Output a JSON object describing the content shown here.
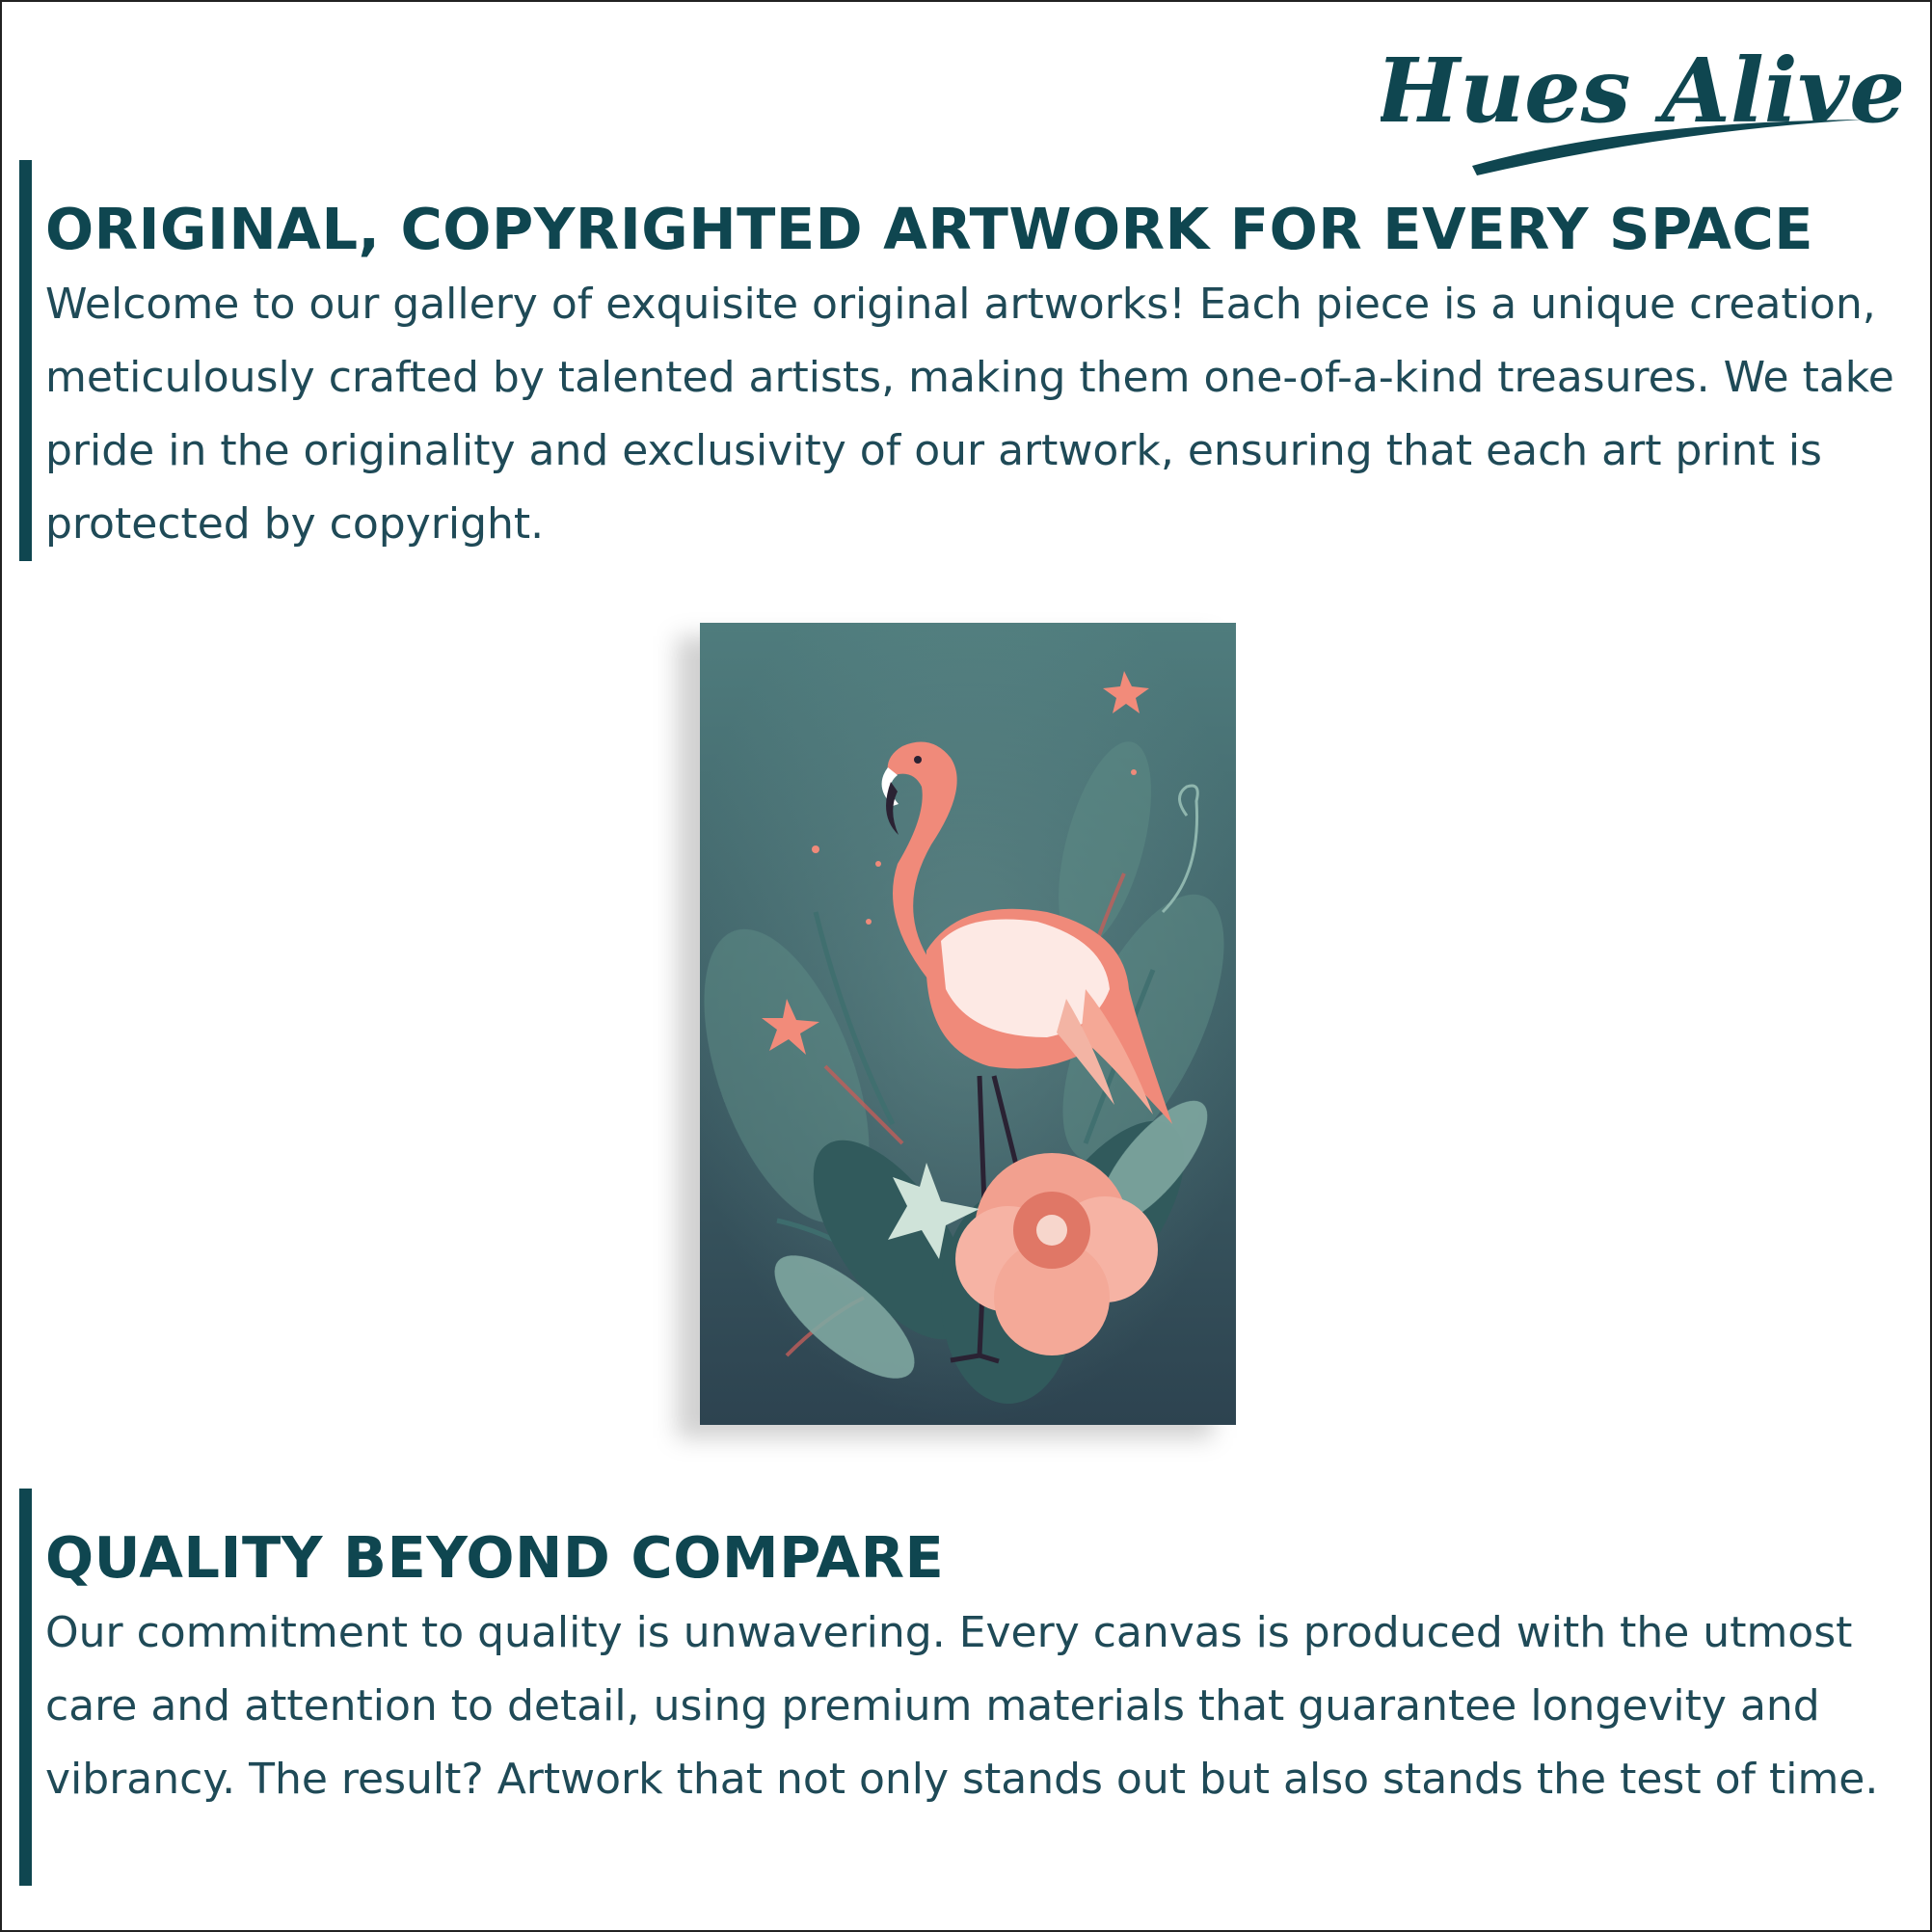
{
  "brand": {
    "logo_text": "Hues Alive"
  },
  "sections": [
    {
      "heading": "ORIGINAL, COPYRIGHTED ARTWORK FOR EVERY SPACE",
      "body": "Welcome to our gallery of exquisite original artworks! Each piece is a unique creation, meticulously crafted by talented artists, making them one-of-a-kind treasures. We take pride in the originality and exclusivity of our artwork, ensuring that each art print is protected by copyright."
    },
    {
      "heading": "QUALITY BEYOND COMPARE",
      "body": "Our commitment to quality is unwavering. Every canvas is produced with the utmost care and attention to detail, using premium materials that guarantee longevity and vibrancy. The result? Artwork that not only stands out but also stands the test of time."
    }
  ],
  "artwork": {
    "subject_icon": "flamingo-artwork"
  },
  "colors": {
    "accent": "#0f4650",
    "text": "#1f4a57",
    "canvas_top": "#4f7c7d",
    "canvas_bottom": "#2d4350",
    "flamingo": "#f08a7a",
    "flower": "#f2a08f"
  }
}
